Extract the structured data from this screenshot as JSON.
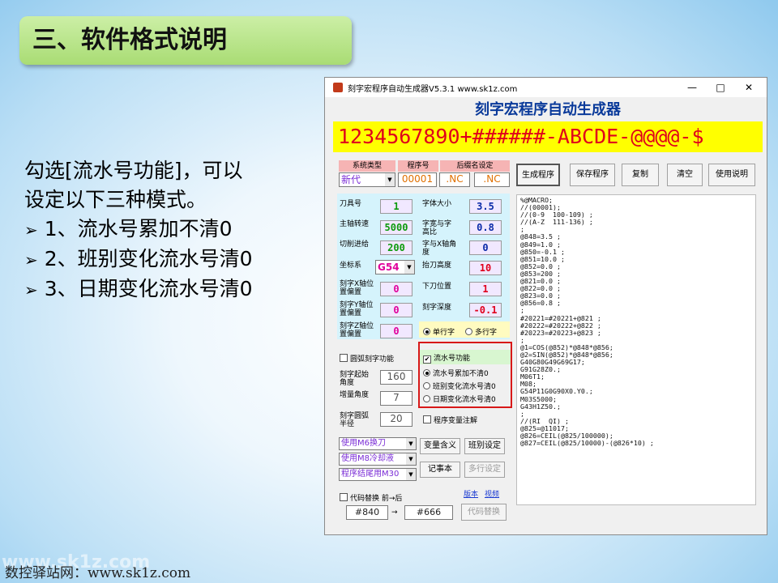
{
  "slide": {
    "title": "三、软件格式说明",
    "desc_line1": "勾选[流水号功能]，可以",
    "desc_line2": "设定以下三种模式。",
    "bullets": [
      "1、流水号累加不清0",
      "2、班别变化流水号清0",
      "3、日期变化流水号清0"
    ],
    "footer": "数控驿站网：www.sk1z.com",
    "watermark": "www.sk1z.com"
  },
  "window": {
    "title": "刻字宏程序自动生成器V5.3.1    www.sk1z.com",
    "minimize": "—",
    "maximize": "□",
    "close": "✕",
    "header": "刻字宏程序自动生成器",
    "pattern": "1234567890+######-ABCDE-@@@@-$"
  },
  "system": {
    "label_system": "系统类型",
    "label_prog": "程序号",
    "label_suffix": "后缀名设定",
    "system_value": "新代",
    "prog_value": "00001",
    "suffix1": ".NC",
    "suffix2": ".NC"
  },
  "params": {
    "tool_label": "刀具号",
    "tool_value": "1",
    "speed_label": "主轴转速",
    "speed_value": "5000",
    "feed_label": "切削进给",
    "feed_value": "200",
    "coord_label": "坐标系",
    "coord_value": "G54",
    "xoff_label": "刻字X轴位置偏置",
    "xoff_value": "0",
    "yoff_label": "刻字Y轴位置偏置",
    "yoff_value": "0",
    "zoff_label": "刻字Z轴位置偏置",
    "zoff_value": "0",
    "size_label": "字体大小",
    "size_value": "3.5",
    "ratio_label": "字宽与字高比",
    "ratio_value": "0.8",
    "angle_label": "字与X轴角度",
    "angle_value": "0",
    "lift_label": "抬刀高度",
    "lift_value": "10",
    "down_label": "下刀位置",
    "down_value": "1",
    "depth_label": "刻字深度",
    "depth_value": "-0.1"
  },
  "options": {
    "single_line": "单行字",
    "multi_line": "多行字",
    "arc_label": "圆弧刻字功能",
    "start_angle_label": "刻字起始角度",
    "start_angle_value": "160",
    "inc_angle_label": "增量角度",
    "inc_angle_value": "7",
    "radius_label": "刻字圆弧半径",
    "radius_value": "20",
    "serial_label": "流水号功能",
    "serial_opt1": "流水号累加不清0",
    "serial_opt2": "班别变化流水号清0",
    "serial_opt3": "日期变化流水号清0",
    "var_comment": "程序变量注解",
    "m6": "使用M6换刀",
    "m8": "使用M8冷却液",
    "m30": "程序结尾用M30",
    "replace_label": "代码替换 前→后",
    "replace_from": "#840",
    "replace_arrow": "→",
    "replace_to": "#666",
    "link_version": "版本",
    "link_video": "视频"
  },
  "buttons": {
    "generate": "生成程序",
    "save": "保存程序",
    "copy": "复制",
    "clear": "清空",
    "help": "使用说明",
    "var_meaning": "变量含义",
    "shift_set": "班别设定",
    "notepad": "记事本",
    "multi_set": "多行设定",
    "code_replace": "代码替换"
  },
  "code_text": "%@MACRO;\n//(00001);\n//(0-9  100-109) ;\n//(A-Z  111-136) ;\n;\n@848=3.5 ;\n@849=1.0 ;\n@850=-0.1 ;\n@851=10.0 ;\n@852=0.0 ;\n@853=200 ;\n@821=0.0 ;\n@822=0.0 ;\n@823=0.0 ;\n@856=0.8 ;\n;\n#20221=#20221+@821 ;\n#20222=#20222+@822 ;\n#20223=#20223+@823 ;\n;\n@1=COS(@852)*@848*@856;\n@2=SIN(@852)*@848*@856;\nG40G80G49G69G17;\nG91G28Z0.;\nM06T1;\nM08;\nG54P11G0G90X0.Y0.;\nM03S5000;\nG43H1Z50.;\n;\n//(RI  QI) ;\n@825=@11017;\n@826=CEIL(@825/100000);\n@827=CEIL(@825/10000)-(@826*10) ;"
}
